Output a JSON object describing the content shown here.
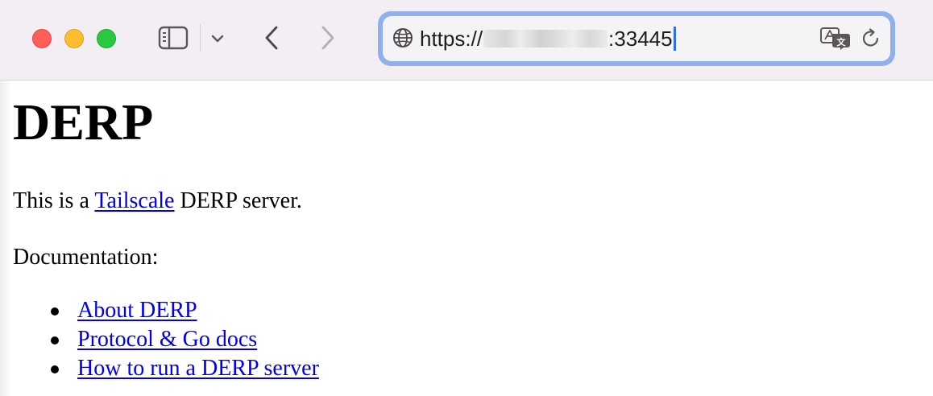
{
  "toolbar": {
    "traffic_lights": {
      "close_color": "#ff5f57",
      "minimize_color": "#febc2e",
      "maximize_color": "#28c840"
    },
    "icons": {
      "sidebar": "sidebar-icon",
      "sidebar_menu": "chevron-down-icon",
      "back": "chevron-left-icon",
      "forward": "chevron-right-icon"
    },
    "forward_enabled": false
  },
  "address_bar": {
    "url_prefix": "https://",
    "url_suffix": ":33445",
    "url_host_redacted": true,
    "focused": true,
    "focus_ring_color": "#8fb0ec",
    "icons": {
      "site": "globe-icon",
      "translate": "translate-icon",
      "reload": "reload-icon"
    }
  },
  "page": {
    "title": "DERP",
    "intro": {
      "before": "This is a ",
      "link": "Tailscale",
      "after": " DERP server."
    },
    "docs_label": "Documentation:",
    "doc_links": [
      {
        "label": "About DERP"
      },
      {
        "label": "Protocol & Go docs"
      },
      {
        "label": "How to run a DERP server"
      }
    ],
    "link_color": "#0000ee"
  }
}
